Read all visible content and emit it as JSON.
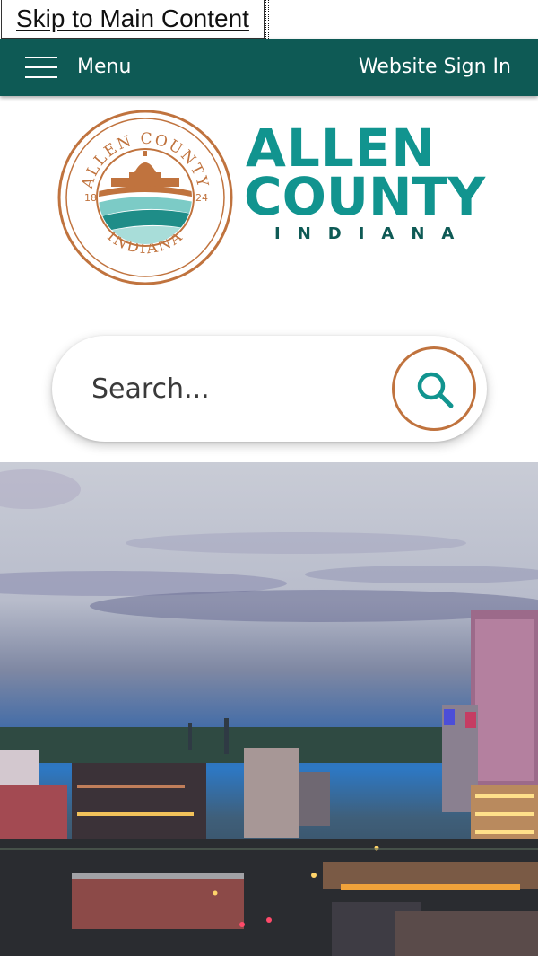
{
  "skip_link": {
    "label": "Skip to Main Content"
  },
  "navbar": {
    "menu_label": "Menu",
    "sign_in_label": "Website Sign In",
    "background": "#0e5a55"
  },
  "logo": {
    "seal_top_text": "ALLEN COUNTY",
    "seal_bottom_text": "INDIANA",
    "seal_year_left": "18",
    "seal_year_right": "24",
    "wordmark_line1": "ALLEN",
    "wordmark_line2": "COUNTY",
    "wordmark_line3": "INDIANA",
    "brand_teal": "#11948f",
    "brand_copper": "#c0733e"
  },
  "search": {
    "placeholder": "Search...",
    "icon": "search-icon"
  },
  "hero": {
    "image": "city-skyline-dusk"
  }
}
